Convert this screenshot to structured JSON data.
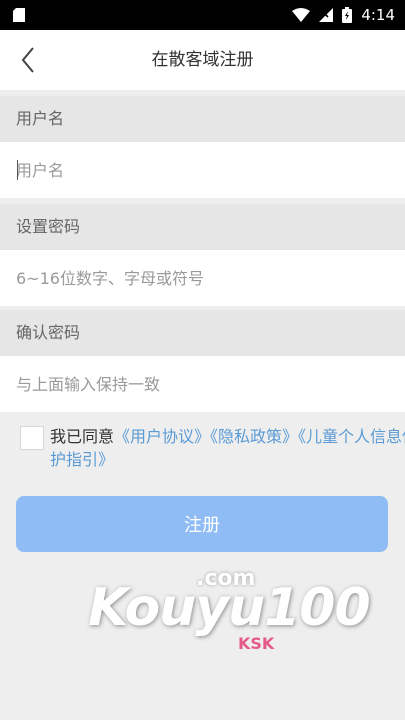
{
  "status_bar": {
    "time": "4:14",
    "icons": [
      "sim-card-icon",
      "wifi-icon",
      "no-signal-icon",
      "battery-icon"
    ]
  },
  "app_bar": {
    "title": "在散客域注册",
    "back_icon": "chevron-left-icon"
  },
  "form": {
    "username_label": "用户名",
    "username_placeholder": "用户名",
    "password_label": "设置密码",
    "password_placeholder": "6~16位数字、字母或符号",
    "confirm_label": "确认密码",
    "confirm_placeholder": "与上面输入保持一致"
  },
  "agreement": {
    "prefix": "我已同意",
    "user_agreement": "《用户协议》",
    "privacy_policy": "《隐私政策》",
    "children_policy": "《儿童个人信息保护指引》"
  },
  "register_button": "注册",
  "watermark": {
    "com": ".com",
    "brand": "Kouyu100",
    "sub": "KSK"
  },
  "colors": {
    "link": "#5b9bd5",
    "button": "#8fbcf4",
    "section_bg": "#e6e6e6"
  }
}
